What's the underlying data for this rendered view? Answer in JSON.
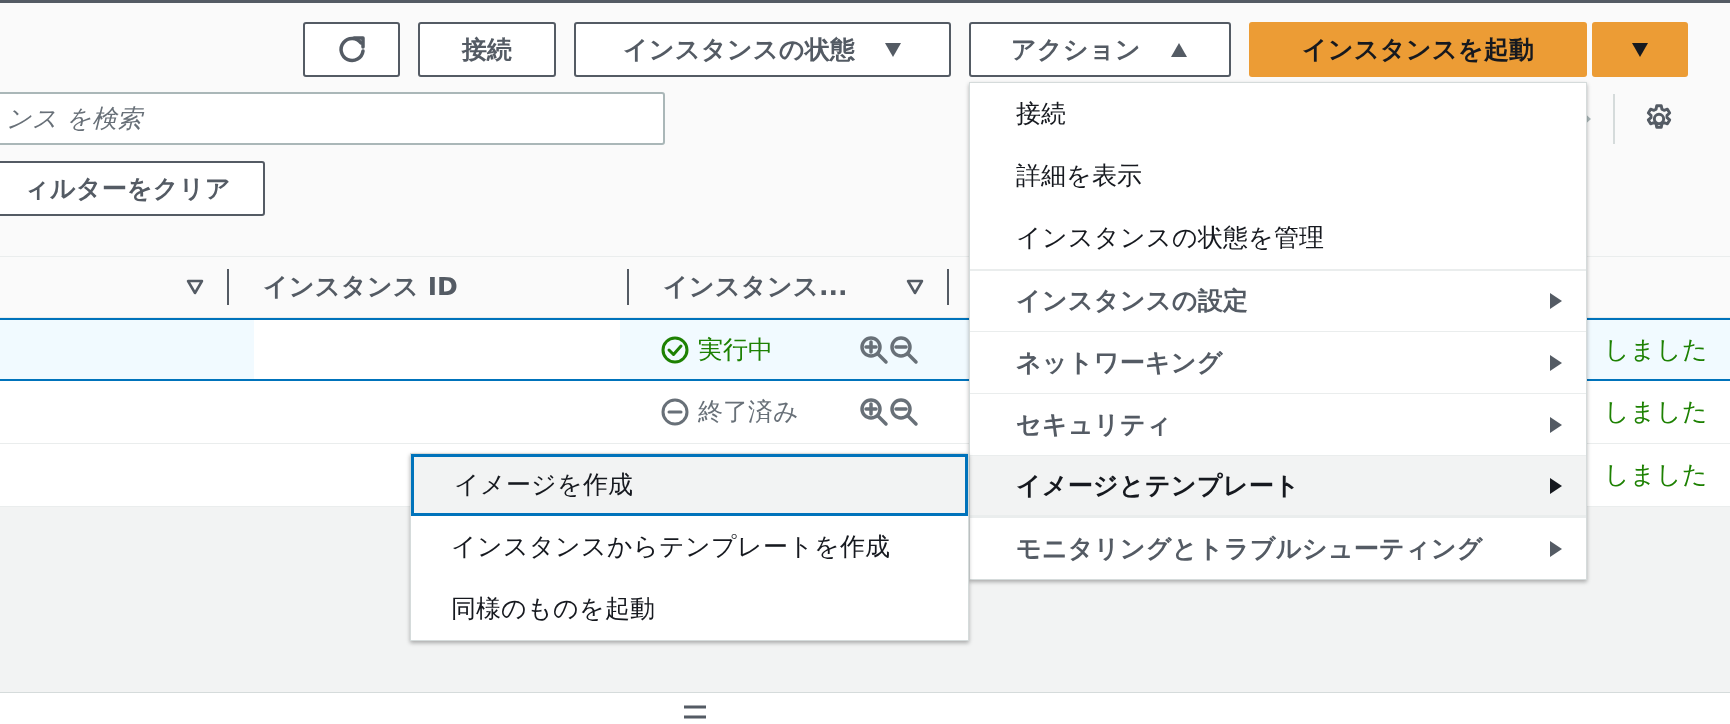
{
  "toolbar": {
    "buttons": [
      {
        "kind": "refresh"
      },
      {
        "kind": "button",
        "label": "接続"
      },
      {
        "kind": "dropdown",
        "label": "インスタンスの状態",
        "expanded": false
      },
      {
        "kind": "dropdown",
        "label": "アクション",
        "expanded": true
      }
    ],
    "launch": {
      "label": "インスタンスを起動"
    }
  },
  "search": {
    "placeholder": "ンス を検索"
  },
  "clear_filter": {
    "label": "ィルターをクリア"
  },
  "table": {
    "columns": [
      {
        "sortable": true
      },
      {
        "label": "インスタンス ID",
        "sortable": false
      },
      {
        "label": "インスタンス...",
        "sortable": true
      }
    ],
    "rows": [
      {
        "selected": true,
        "kind": "running",
        "status": "実行中",
        "column_4": "しました"
      },
      {
        "selected": false,
        "kind": "terminated",
        "status": "終了済み",
        "column_4": "しました"
      },
      {
        "selected": false,
        "column_4": "しました"
      }
    ]
  },
  "actions_menu": {
    "items": [
      {
        "kind": "item",
        "label": "接続",
        "selected": false
      },
      {
        "kind": "item",
        "label": "詳細を表示",
        "selected": false
      },
      {
        "kind": "item",
        "label": "インスタンスの状態を管理",
        "selected": false
      },
      {
        "kind": "submenu",
        "label": "インスタンスの設定",
        "selected": false
      },
      {
        "kind": "submenu",
        "label": "ネットワーキング",
        "selected": false
      },
      {
        "kind": "submenu",
        "label": "セキュリティ",
        "selected": false
      },
      {
        "kind": "submenu",
        "label": "イメージとテンプレート",
        "selected": true
      },
      {
        "kind": "submenu",
        "label": "モニタリングとトラブルシューティング",
        "selected": false
      }
    ]
  },
  "submenu": {
    "items": [
      {
        "label": "イメージを作成",
        "selected": true
      },
      {
        "label": "インスタンスからテンプレートを作成",
        "selected": false
      },
      {
        "label": "同様のものを起動",
        "selected": false
      }
    ]
  }
}
